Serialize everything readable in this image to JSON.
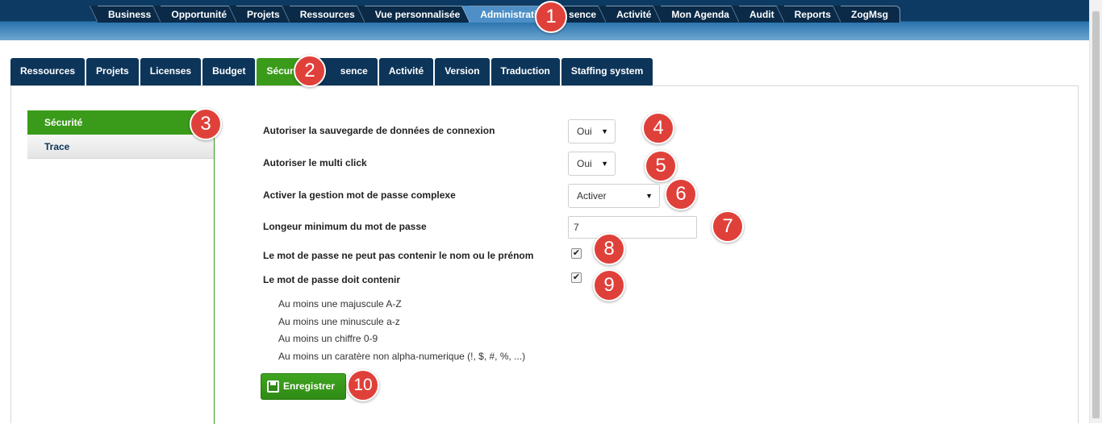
{
  "top_nav": {
    "items": [
      {
        "label": "Business"
      },
      {
        "label": "Opportunité"
      },
      {
        "label": "Projets"
      },
      {
        "label": "Ressources"
      },
      {
        "label": "Vue personnalisée"
      },
      {
        "label": "Administration",
        "active": true
      },
      {
        "label": "sence"
      },
      {
        "label": "Activité"
      },
      {
        "label": "Mon Agenda"
      },
      {
        "label": "Audit"
      },
      {
        "label": "Reports"
      },
      {
        "label": "ZogMsg"
      }
    ]
  },
  "sub_tabs": {
    "items": [
      {
        "label": "Ressources"
      },
      {
        "label": "Projets"
      },
      {
        "label": "Licenses"
      },
      {
        "label": "Budget"
      },
      {
        "label": "Sécurité",
        "active": true
      },
      {
        "label": "sence"
      },
      {
        "label": "Activité"
      },
      {
        "label": "Version"
      },
      {
        "label": "Traduction"
      },
      {
        "label": "Staffing system"
      }
    ]
  },
  "side_nav": {
    "items": [
      {
        "label": "Sécurité",
        "active": true
      },
      {
        "label": "Trace"
      }
    ]
  },
  "form": {
    "save_login": {
      "label": "Autoriser la sauvegarde de données de connexion",
      "value": "Oui"
    },
    "multi_click": {
      "label": "Autoriser le multi click",
      "value": "Oui"
    },
    "complex_password": {
      "label": "Activer la gestion mot de passe complexe",
      "value": "Activer"
    },
    "min_length": {
      "label": "Longeur minimum du mot de passe",
      "value": "7"
    },
    "no_name": {
      "label": "Le mot de passe ne peut pas contenir le nom ou le prénom",
      "checked": true
    },
    "must_contain": {
      "label": "Le mot de passe doit contenir",
      "checked": true
    },
    "requirements": [
      "Au moins une majuscule A-Z",
      "Au moins une minuscule a-z",
      "Au moins un chiffre 0-9",
      "Au moins un caratère non alpha-numerique (!, $, #, %, ...)"
    ],
    "save_button": "Enregistrer"
  },
  "check_glyph": "✔",
  "select_arrow": "▼",
  "icons": {
    "save": "floppy-disk-icon"
  },
  "callouts": [
    "1",
    "2",
    "3",
    "4",
    "5",
    "6",
    "7",
    "8",
    "9",
    "10"
  ],
  "colors": {
    "header_dark": "#0d3a63",
    "tab_dark": "#0c3559",
    "active_green": "#3a9b1a",
    "active_blue": "#4d8fc6",
    "callout_red": "#e0403a"
  }
}
